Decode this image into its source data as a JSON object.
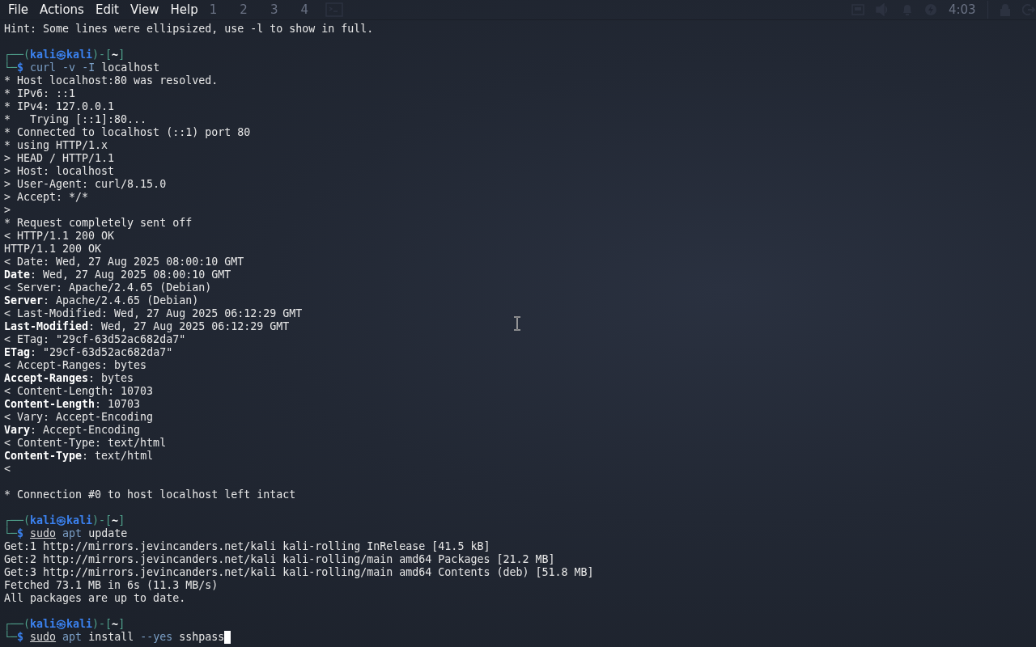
{
  "menu": [
    "File",
    "Actions",
    "Edit",
    "View",
    "Help"
  ],
  "panel": {
    "workspaces": [
      "1",
      "2",
      "3",
      "4"
    ],
    "clock": "4:03"
  },
  "lines": [
    {
      "kind": "text",
      "text": "Hint: Some lines were ellipsized, use -l to show in full."
    },
    {
      "kind": "blank"
    },
    {
      "kind": "prompt",
      "open": "┌──(",
      "user": "kali㉿kali",
      "mid": ")-[",
      "dir": "~",
      "close": "]"
    },
    {
      "kind": "command",
      "lead": "└─",
      "sigil": "$",
      "cursor": false,
      "tokens": [
        {
          "kind": "command",
          "text": "curl"
        },
        {
          "kind": "option",
          "text": "-v"
        },
        {
          "kind": "option",
          "text": "-I"
        },
        {
          "kind": "arg",
          "text": "localhost"
        }
      ]
    },
    {
      "kind": "text",
      "text": "* Host localhost:80 was resolved."
    },
    {
      "kind": "text",
      "text": "* IPv6: ::1"
    },
    {
      "kind": "text",
      "text": "* IPv4: 127.0.0.1"
    },
    {
      "kind": "text",
      "text": "*   Trying [::1]:80..."
    },
    {
      "kind": "text",
      "text": "* Connected to localhost (::1) port 80"
    },
    {
      "kind": "text",
      "text": "* using HTTP/1.x"
    },
    {
      "kind": "text",
      "text": "> HEAD / HTTP/1.1"
    },
    {
      "kind": "text",
      "text": "> Host: localhost"
    },
    {
      "kind": "text",
      "text": "> User-Agent: curl/8.15.0"
    },
    {
      "kind": "text",
      "text": "> Accept: */*"
    },
    {
      "kind": "text",
      "text": ">"
    },
    {
      "kind": "text",
      "text": "* Request completely sent off"
    },
    {
      "kind": "text",
      "text": "< HTTP/1.1 200 OK"
    },
    {
      "kind": "text",
      "text": "HTTP/1.1 200 OK"
    },
    {
      "kind": "text",
      "text": "< Date: Wed, 27 Aug 2025 08:00:10 GMT"
    },
    {
      "kind": "header",
      "text": "**Date**: Wed, 27 Aug 2025 08:00:10 GMT"
    },
    {
      "kind": "text",
      "text": "< Server: Apache/2.4.65 (Debian)"
    },
    {
      "kind": "header",
      "text": "**Server**: Apache/2.4.65 (Debian)"
    },
    {
      "kind": "text",
      "text": "< Last-Modified: Wed, 27 Aug 2025 06:12:29 GMT"
    },
    {
      "kind": "header",
      "text": "**Last-Modified**: Wed, 27 Aug 2025 06:12:29 GMT"
    },
    {
      "kind": "text",
      "text": "< ETag: \"29cf-63d52ac682da7\""
    },
    {
      "kind": "header",
      "text": "**ETag**: \"29cf-63d52ac682da7\""
    },
    {
      "kind": "text",
      "text": "< Accept-Ranges: bytes"
    },
    {
      "kind": "header",
      "text": "**Accept-Ranges**: bytes"
    },
    {
      "kind": "text",
      "text": "< Content-Length: 10703"
    },
    {
      "kind": "header",
      "text": "**Content-Length**: 10703"
    },
    {
      "kind": "text",
      "text": "< Vary: Accept-Encoding"
    },
    {
      "kind": "header",
      "text": "**Vary**: Accept-Encoding"
    },
    {
      "kind": "text",
      "text": "< Content-Type: text/html"
    },
    {
      "kind": "header",
      "text": "**Content-Type**: text/html"
    },
    {
      "kind": "text",
      "text": "<"
    },
    {
      "kind": "blank"
    },
    {
      "kind": "text",
      "text": "* Connection #0 to host localhost left intact"
    },
    {
      "kind": "blank"
    },
    {
      "kind": "prompt",
      "open": "┌──(",
      "user": "kali㉿kali",
      "mid": ")-[",
      "dir": "~",
      "close": "]"
    },
    {
      "kind": "command",
      "lead": "└─",
      "sigil": "$",
      "cursor": false,
      "tokens": [
        {
          "kind": "precommand",
          "text": "sudo"
        },
        {
          "kind": "command",
          "text": "apt"
        },
        {
          "kind": "arg",
          "text": "update"
        }
      ]
    },
    {
      "kind": "text",
      "text": "Get:1 http://mirrors.jevincanders.net/kali kali-rolling InRelease [41.5 kB]"
    },
    {
      "kind": "text",
      "text": "Get:2 http://mirrors.jevincanders.net/kali kali-rolling/main amd64 Packages [21.2 MB]"
    },
    {
      "kind": "text",
      "text": "Get:3 http://mirrors.jevincanders.net/kali kali-rolling/main amd64 Contents (deb) [51.8 MB]"
    },
    {
      "kind": "text",
      "text": "Fetched 73.1 MB in 6s (11.3 MB/s)"
    },
    {
      "kind": "text",
      "text": "All packages are up to date."
    },
    {
      "kind": "blank"
    },
    {
      "kind": "prompt",
      "open": "┌──(",
      "user": "kali㉿kali",
      "mid": ")-[",
      "dir": "~",
      "close": "]"
    },
    {
      "kind": "command",
      "lead": "└─",
      "sigil": "$",
      "cursor": true,
      "tokens": [
        {
          "kind": "precommand",
          "text": "sudo"
        },
        {
          "kind": "command",
          "text": "apt"
        },
        {
          "kind": "arg",
          "text": "install"
        },
        {
          "kind": "option",
          "text": "--yes"
        },
        {
          "kind": "arg",
          "text": "sshpass"
        }
      ]
    }
  ]
}
